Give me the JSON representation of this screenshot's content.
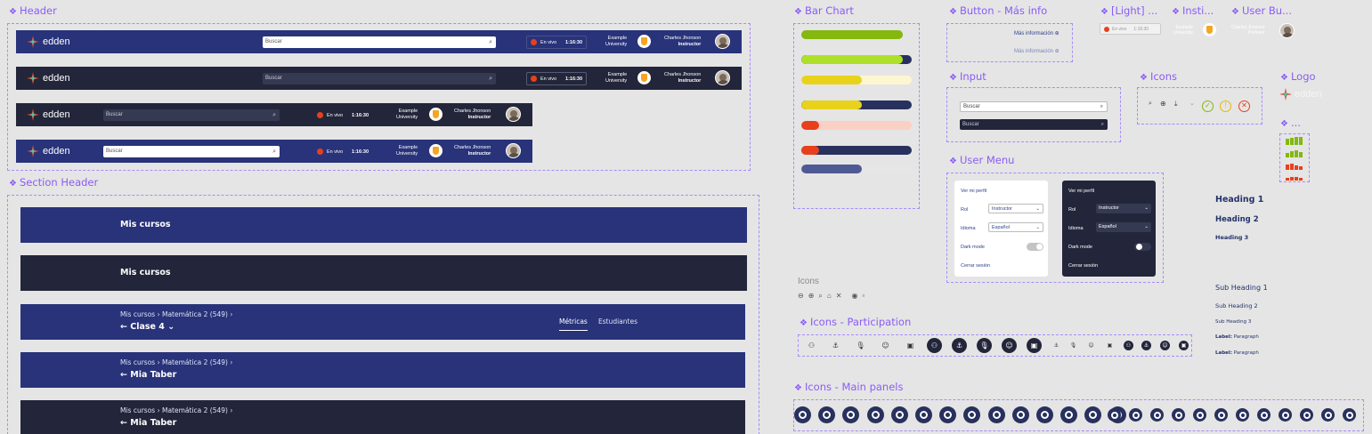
{
  "frames": {
    "header": "Header",
    "section_header": "Section Header",
    "bar_chart": "Bar Chart",
    "button_more_info": "Button - Más info",
    "light": "[Light] ...",
    "insti": "Insti...",
    "user_bu": "User Bu...",
    "input": "Input",
    "icons": "Icons",
    "logo": "Logo",
    "misc": "...",
    "user_menu": "User Menu",
    "icons_participation": "Icons - Participation",
    "icons_main_panels": "Icons - Main panels"
  },
  "header": {
    "brand": "edden",
    "search_placeholder": "Buscar",
    "live_label": "En vivo",
    "live_time": "1:16:30",
    "university_line1": "Example",
    "university_line2": "University",
    "user_name": "Charles Jhonson",
    "user_role": "Instructor"
  },
  "section_header": {
    "title": "Mis cursos",
    "breadcrumb": "Mis cursos  ›  Matemática 2 (549)  ›",
    "class_title": "← Clase 4 ⌄",
    "student_title": "← Mia Taber",
    "tab_metrics": "Métricas",
    "tab_students": "Estudiantes"
  },
  "bar_chart": {
    "bars": [
      {
        "value": 1.0,
        "fill": "#84b80f",
        "track": "#84b80f"
      },
      {
        "value": 0.92,
        "fill": "#aee02a",
        "track": "#28305e"
      },
      {
        "value": 0.55,
        "fill": "#e8d21c",
        "track": "#fdf6d0"
      },
      {
        "value": 0.55,
        "fill": "#e8d21c",
        "track": "#28305e"
      },
      {
        "value": 0.16,
        "fill": "#e8401c",
        "track": "#fbd0c4"
      },
      {
        "value": 0.16,
        "fill": "#e8401c",
        "track": "#28305e"
      },
      {
        "value": 0.55,
        "fill": "#4f5a94",
        "track": "#e6e6e6"
      }
    ]
  },
  "button_more_info": {
    "label": "Más información ⊕"
  },
  "light": {
    "live_label": "En vivo",
    "live_time": "1:16:30"
  },
  "insti": {
    "line1": "Example",
    "line2": "University"
  },
  "user_bu": {
    "name": "Charles Jhonson",
    "role": "Profesor"
  },
  "input": {
    "placeholder": "Buscar"
  },
  "icons_misc_label": "Icons",
  "user_menu": {
    "profile": "Ver mi perfil",
    "role_label": "Rol",
    "role_value": "Instructor",
    "language_label": "Idioma",
    "language_value": "Español",
    "dark_mode": "Dark mode",
    "logout": "Cerrar sesión"
  },
  "typography": {
    "h1": "Heading 1",
    "h2": "Heading 2",
    "h3": "Heading 3",
    "sh1": "Sub Heading 1",
    "sh2": "Sub Heading 2",
    "sh3": "Sub Heading 3",
    "label": "Label:",
    "paragraph": "Paragraph"
  },
  "colors": {
    "navy": "#28337a",
    "dark": "#23263a",
    "accent": "#8b5cf6",
    "live_red": "#e8401c",
    "shield": "#f5a524"
  }
}
